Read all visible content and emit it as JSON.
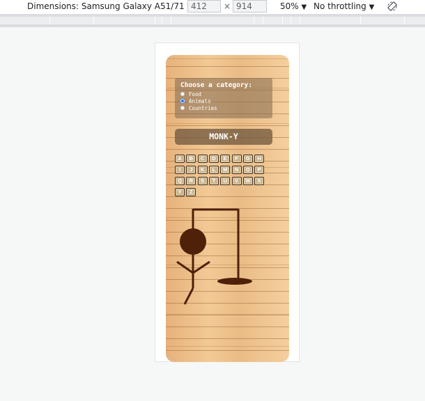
{
  "devtools": {
    "dimensions_label": "Dimensions: Samsung Galaxy A51/71",
    "width_value": "412",
    "times": "×",
    "height_value": "914",
    "zoom": "50%",
    "throttling": "No throttling",
    "dropdown_arrow": "▼"
  },
  "game": {
    "category_title": "Choose a category:",
    "categories": [
      {
        "label": "Food",
        "checked": false
      },
      {
        "label": "Animals",
        "checked": true
      },
      {
        "label": "Countries",
        "checked": false
      }
    ],
    "word": "MONK-Y",
    "letters": [
      "A",
      "B",
      "C",
      "D",
      "E",
      "F",
      "G",
      "H",
      "I",
      "J",
      "K",
      "L",
      "M",
      "N",
      "O",
      "P",
      "Q",
      "R",
      "S",
      "T",
      "U",
      "V",
      "W",
      "X",
      "Y",
      "Z"
    ],
    "figure_color": "#4e2108"
  }
}
